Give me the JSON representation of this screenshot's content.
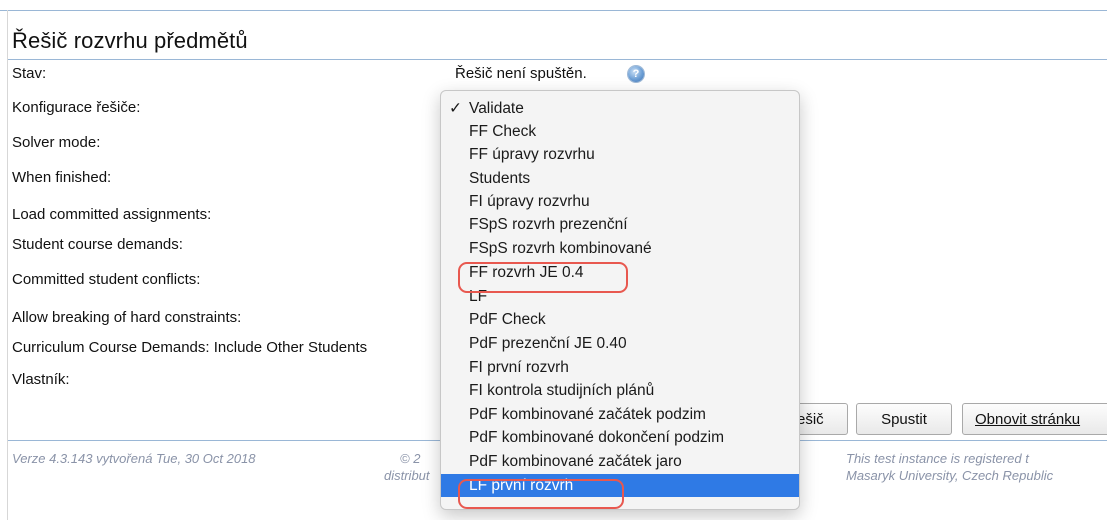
{
  "page": {
    "title": "Řešič rozvrhu předmětů"
  },
  "form": {
    "rows": [
      {
        "label": "Stav:",
        "value": "Řešič není spuštěn."
      },
      {
        "label": "Konfigurace řešiče:"
      },
      {
        "label": "Solver mode:"
      },
      {
        "label": "When finished:"
      },
      {
        "label": "Load committed assignments:"
      },
      {
        "label": "Student course demands:"
      },
      {
        "label": "Committed student conflicts:"
      },
      {
        "label": "Allow breaking of hard constraints:"
      },
      {
        "label": "Curriculum Course Demands: Include Other Students"
      },
      {
        "label": "Vlastník:"
      }
    ]
  },
  "buttons": {
    "partial_label": "ešič",
    "start_label": "Spustit",
    "refresh_label": "Obnovit stránku"
  },
  "footer": {
    "version": "Verze 4.3.143 vytvořená Tue, 30 Oct 2018",
    "copyright_partial": "© 2",
    "distrib_partial": "distribut",
    "registration_line1": "This test instance is registered t",
    "registration_line2": "Masaryk University, Czech Republic"
  },
  "dropdown": {
    "checkmark": "✓",
    "options": [
      {
        "label": "Validate",
        "checked": true
      },
      {
        "label": "FF Check"
      },
      {
        "label": "FF úpravy rozvrhu"
      },
      {
        "label": "Students"
      },
      {
        "label": "FI úpravy rozvrhu"
      },
      {
        "label": "FSpS rozvrh prezenční"
      },
      {
        "label": "FSpS rozvrh kombinované"
      },
      {
        "label": "FF rozvrh JE 0.4",
        "annotated": true
      },
      {
        "label": "LF"
      },
      {
        "label": "PdF Check"
      },
      {
        "label": "PdF prezenční JE 0.40"
      },
      {
        "label": "FI první rozvrh"
      },
      {
        "label": "FI kontrola studijních plánů"
      },
      {
        "label": "PdF kombinované začátek podzim"
      },
      {
        "label": "PdF kombinované dokončení podzim"
      },
      {
        "label": "PdF kombinované začátek jaro"
      },
      {
        "label": "LF první rozvrh",
        "highlighted": true,
        "annotated": true
      }
    ]
  },
  "colors": {
    "accent": "#2f7ae5",
    "annotation": "#e8584f",
    "rule": "#9ab7d6"
  }
}
